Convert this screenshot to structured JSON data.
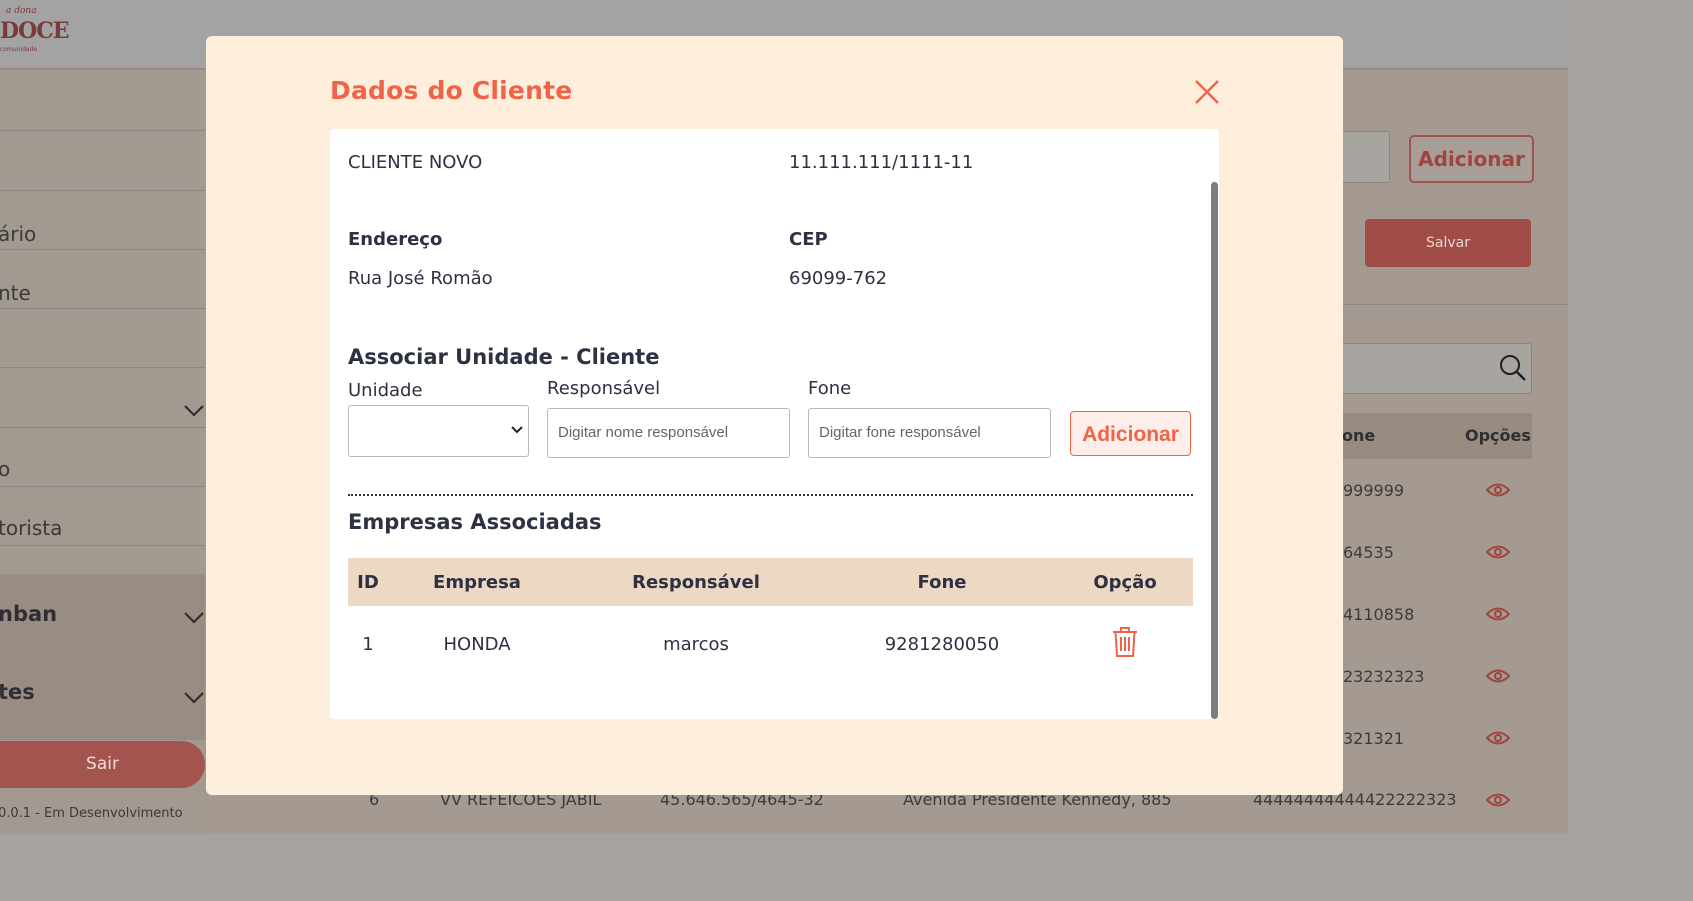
{
  "background": {
    "logo": {
      "small": "a dona",
      "big": "DOCE",
      "tiny": "comunidade"
    },
    "sidebar": {
      "items": [
        "ário",
        "nte",
        "o",
        "torista"
      ],
      "sections": [
        "nban",
        "tes"
      ],
      "logout_label": "Sair",
      "version": "0.0.1 - Em Desenvolvimento"
    },
    "main": {
      "add_label": "Adicionar",
      "save_label": "Salvar",
      "table_headers": [
        "one",
        "Opções"
      ],
      "phones": [
        "999999",
        "64535",
        "4110858",
        "23232323",
        "321321"
      ],
      "last_row": {
        "id": "6",
        "name": "VV REFEICOES JABIL",
        "cnpj": "45.646.565/4645-32",
        "address": "Avenida Presidente Kennedy, 885",
        "phone": "44444444444422222323"
      }
    }
  },
  "modal": {
    "title": "Dados do Cliente",
    "client": {
      "name": "CLIENTE NOVO",
      "cnpj": "11.111.111/1111-11",
      "address_label": "Endereço",
      "address": "Rua José Romão",
      "cep_label": "CEP",
      "cep": "69099-762"
    },
    "associate": {
      "heading": "Associar Unidade - Cliente",
      "unit_label": "Unidade",
      "responsible_label": "Responsável",
      "responsible_placeholder": "Digitar nome responsável",
      "phone_label": "Fone",
      "phone_placeholder": "Digitar fone responsável",
      "add_label": "Adicionar"
    },
    "companies": {
      "heading": "Empresas Associadas",
      "headers": [
        "ID",
        "Empresa",
        "Responsável",
        "Fone",
        "Opção"
      ],
      "rows": [
        {
          "id": "1",
          "empresa": "HONDA",
          "responsavel": "marcos",
          "fone": "9281280050"
        }
      ]
    }
  },
  "colors": {
    "accent": "#ef6448",
    "modal_bg": "#feeedc",
    "table_header_bg": "#ecd8c3",
    "text": "#2d3142"
  }
}
